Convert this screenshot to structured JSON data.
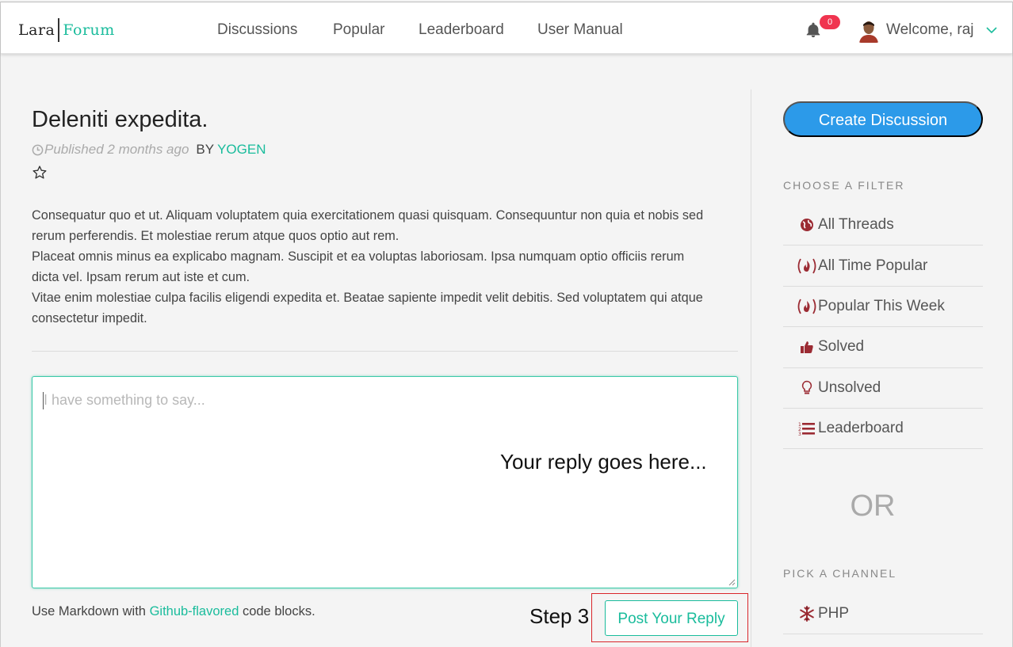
{
  "nav": {
    "logo_left": "Lara",
    "logo_right": "Forum",
    "links": [
      "Discussions",
      "Popular",
      "Leaderboard",
      "User Manual"
    ],
    "notification_count": "0",
    "welcome": "Welcome, raj"
  },
  "thread": {
    "title": "Deleniti expedita.",
    "published": "Published 2 months ago",
    "by_label": "BY",
    "author": "YOGEN",
    "body": [
      "Consequatur quo et ut. Aliquam voluptatem quia exercitationem quasi quisquam. Consequuntur non quia et nobis sed rerum perferendis. Et molestiae rerum atque quos optio aut rem.",
      "Placeat omnis minus ea explicabo magnam. Suscipit et ea voluptas laboriosam. Ipsa numquam optio officiis rerum dicta vel. Ipsam rerum aut iste et cum.",
      "Vitae enim molestiae culpa facilis eligendi expedita et. Beatae sapiente impedit velit debitis. Sed voluptatem qui atque consectetur impedit."
    ]
  },
  "reply": {
    "placeholder": "I have something to say...",
    "hint": "Your reply goes here...",
    "markdown_prefix": "Use Markdown with ",
    "markdown_link": "Github-flavored",
    "markdown_suffix": " code blocks.",
    "step_label": "Step 3",
    "post_button": "Post Your Reply"
  },
  "sidebar": {
    "create_button": "Create Discussion",
    "filter_heading": "CHOOSE A FILTER",
    "filters": [
      {
        "label": "All Threads",
        "icon": "globe-icon"
      },
      {
        "label": "All Time Popular",
        "icon": "fire-icon"
      },
      {
        "label": "Popular This Week",
        "icon": "fire-icon"
      },
      {
        "label": "Solved",
        "icon": "thumbs-up-icon"
      },
      {
        "label": "Unsolved",
        "icon": "lightbulb-icon"
      },
      {
        "label": "Leaderboard",
        "icon": "list-icon"
      }
    ],
    "or_text": "OR",
    "channel_heading": "PICK A CHANNEL",
    "channels": [
      {
        "label": "PHP",
        "icon": "snowflake-icon"
      }
    ]
  },
  "colors": {
    "accent": "#1abc9c",
    "primary_button": "#2c9ae9",
    "badge": "#f0344f",
    "icon_red": "#9b2b33",
    "highlight_box": "#d9262b"
  }
}
